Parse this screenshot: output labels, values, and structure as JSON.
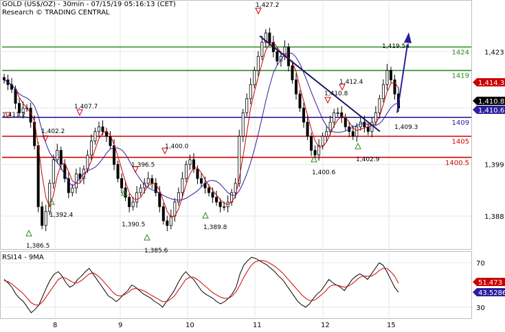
{
  "header": {
    "title": "GOLD (US$/OZ) - 30min - 07/15/19 05:16:13 (CET)",
    "research": "Research © TRADING CENTRAL"
  },
  "rsi_panel": {
    "label": "RSI14 - 9MA"
  },
  "colors": {
    "candle": "#000000",
    "ma_fast": "#cc0000",
    "ma_slow": "#2a1f9c",
    "support_resistance_green": "#2e8b22",
    "support_red": "#cc0000",
    "pivot_blue": "#2a1f9c",
    "arrow": "#2a1f9c",
    "grid": "#e6e6e6"
  },
  "chart_data": [
    {
      "type": "candlestick",
      "title": "GOLD (US$/OZ) - 30min",
      "x_ticks": [
        "8",
        "9",
        "10",
        "11",
        "12",
        "15"
      ],
      "ylim": [
        1381,
        1434
      ],
      "y_ticks": [
        "1,423",
        "1,411",
        "1,399",
        "1,388"
      ],
      "y_tick_values": [
        1423,
        1411,
        1399,
        1388
      ],
      "horizontal_levels": [
        {
          "value": 1424,
          "label": "1424",
          "color": "green"
        },
        {
          "value": 1419,
          "label": "1419",
          "color": "green"
        },
        {
          "value": 1409,
          "label": "1409",
          "color": "blue"
        },
        {
          "value": 1405,
          "label": "1405",
          "color": "red"
        },
        {
          "value": 1400.5,
          "label": "1400.5",
          "color": "red"
        }
      ],
      "price_tags": [
        {
          "value": 1414.35,
          "label": "1,414.35",
          "style": "red"
        },
        {
          "value": 1410.81,
          "label": "1,410.81",
          "style": "black"
        },
        {
          "value": 1410.61,
          "label": "1,410.61",
          "style": "blue"
        }
      ],
      "swing_annotations": [
        {
          "label": "1,411.2",
          "value": 1411.2,
          "type": "high"
        },
        {
          "label": "1,386.5",
          "value": 1386.5,
          "type": "low"
        },
        {
          "label": "1,402.2",
          "value": 1402.2,
          "type": "high"
        },
        {
          "label": "1,392.4",
          "value": 1392.4,
          "type": "low"
        },
        {
          "label": "1,407.7",
          "value": 1407.7,
          "type": "high"
        },
        {
          "label": "1,390.5",
          "value": 1390.5,
          "type": "low"
        },
        {
          "label": "1,396.5",
          "value": 1396.5,
          "type": "high"
        },
        {
          "label": "1,385.6",
          "value": 1385.6,
          "type": "low"
        },
        {
          "label": "1,400.0",
          "value": 1400.0,
          "type": "high"
        },
        {
          "label": "1,389.8",
          "value": 1389.8,
          "type": "low"
        },
        {
          "label": "1,427.2",
          "value": 1427.2,
          "type": "high"
        },
        {
          "label": "1,400.6",
          "value": 1400.6,
          "type": "low"
        },
        {
          "label": "1,410.8",
          "value": 1410.8,
          "type": "high"
        },
        {
          "label": "1,412.4",
          "value": 1412.4,
          "type": "high"
        },
        {
          "label": "1,402.9",
          "value": 1402.9,
          "type": "low"
        },
        {
          "label": "1,409.3",
          "value": 1409.3,
          "type": "level"
        },
        {
          "label": "1,419.54",
          "value": 1419.54,
          "type": "target"
        }
      ],
      "close_path_approx": [
        1417,
        1416,
        1415,
        1412,
        1410,
        1411,
        1411,
        1408,
        1403,
        1390,
        1386,
        1389,
        1395,
        1400,
        1402,
        1399,
        1396,
        1393,
        1394,
        1397,
        1396,
        1398,
        1401,
        1404,
        1406,
        1407,
        1406,
        1405,
        1403,
        1399,
        1396,
        1394,
        1392,
        1390,
        1391,
        1393,
        1394,
        1395,
        1396,
        1395,
        1393,
        1390,
        1387,
        1386,
        1388,
        1391,
        1393,
        1396,
        1399,
        1400,
        1398,
        1396,
        1395,
        1394,
        1393,
        1392,
        1391,
        1390,
        1390,
        1391,
        1393,
        1395,
        1405,
        1410,
        1413,
        1416,
        1419,
        1422,
        1425,
        1427,
        1425,
        1423,
        1421,
        1422,
        1424,
        1420,
        1417,
        1414,
        1411,
        1408,
        1405,
        1402,
        1401,
        1403,
        1405,
        1406,
        1408,
        1410,
        1410,
        1409,
        1407,
        1406,
        1405,
        1407,
        1408,
        1407,
        1406,
        1408,
        1410,
        1413,
        1416,
        1419,
        1417,
        1414,
        1411
      ]
    },
    {
      "type": "line",
      "title": "RSI14 - 9MA",
      "ylim": [
        20,
        80
      ],
      "y_ticks": [
        "70",
        "30"
      ],
      "y_tick_values": [
        70,
        30
      ],
      "price_tags": [
        {
          "value": 51.473,
          "label": "51.473",
          "style": "red"
        },
        {
          "value": 43.5286,
          "label": "43.5286",
          "style": "blue"
        }
      ],
      "series": [
        {
          "values": [
            55,
            52,
            48,
            42,
            38,
            35,
            30,
            25,
            28,
            32,
            40,
            48,
            55,
            60,
            62,
            58,
            52,
            48,
            50,
            55,
            58,
            62,
            65,
            60,
            55,
            50,
            45,
            40,
            38,
            35,
            38,
            42,
            45,
            50,
            48,
            45,
            42,
            40,
            38,
            35,
            33,
            30,
            35,
            40,
            45,
            52,
            58,
            62,
            58,
            55,
            50,
            45,
            42,
            40,
            38,
            35,
            33,
            35,
            38,
            42,
            48,
            60,
            68,
            72,
            75,
            74,
            72,
            70,
            68,
            65,
            62,
            58,
            55,
            50,
            45,
            40,
            35,
            32,
            30,
            33,
            38,
            42,
            45,
            50,
            55,
            52,
            50,
            48,
            45,
            50,
            55,
            58,
            60,
            58,
            55,
            60,
            65,
            70,
            68,
            62,
            55,
            48,
            43.5
          ]
        },
        {
          "name": "MA",
          "values": [
            54,
            53,
            51,
            48,
            45,
            42,
            38,
            34,
            32,
            32,
            35,
            40,
            45,
            50,
            55,
            57,
            56,
            54,
            52,
            52,
            54,
            57,
            60,
            61,
            59,
            56,
            52,
            48,
            44,
            41,
            40,
            41,
            43,
            46,
            47,
            46,
            45,
            43,
            41,
            39,
            37,
            35,
            35,
            37,
            40,
            45,
            50,
            55,
            57,
            57,
            55,
            52,
            49,
            46,
            43,
            41,
            39,
            38,
            38,
            40,
            44,
            50,
            57,
            63,
            68,
            71,
            72,
            72,
            71,
            69,
            67,
            64,
            61,
            57,
            53,
            49,
            45,
            41,
            38,
            36,
            36,
            38,
            41,
            44,
            48,
            50,
            50,
            49,
            48,
            49,
            51,
            54,
            57,
            58,
            58,
            58,
            60,
            63,
            65,
            65,
            62,
            58,
            51.5
          ]
        }
      ]
    }
  ]
}
